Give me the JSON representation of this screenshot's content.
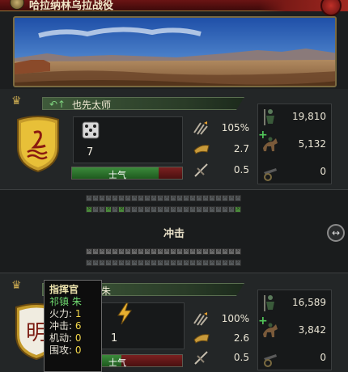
{
  "window": {
    "title": "哈拉纳林乌拉战役"
  },
  "phase": {
    "label": "冲击"
  },
  "attacker": {
    "leader": "也先太师",
    "dice": "7",
    "morale_label": "士气",
    "morale": 0.79,
    "stats": [
      {
        "icon": "fire-icon",
        "value": "105%"
      },
      {
        "icon": "shock-icon",
        "value": "2.7"
      },
      {
        "icon": "siege-icon",
        "value": "0.5"
      }
    ],
    "forces": [
      {
        "icon": "infantry-icon",
        "value": "19,810"
      },
      {
        "icon": "cavalry-icon",
        "value": "5,132"
      },
      {
        "icon": "artillery-icon",
        "value": "0"
      }
    ]
  },
  "defender": {
    "leader": "朱",
    "dice": "1",
    "morale_label": "士气",
    "morale": 0.45,
    "stats": [
      {
        "icon": "fire-icon",
        "value": "100%"
      },
      {
        "icon": "shock-icon",
        "value": "2.6"
      },
      {
        "icon": "siege-icon",
        "value": "0.5"
      }
    ],
    "forces": [
      {
        "icon": "infantry-icon",
        "value": "16,589"
      },
      {
        "icon": "cavalry-icon",
        "value": "3,842"
      },
      {
        "icon": "artillery-icon",
        "value": "0"
      }
    ]
  },
  "tooltip": {
    "title": "指挥官",
    "name": "祁镇 朱",
    "rows": [
      {
        "label": "火力: ",
        "value": "1"
      },
      {
        "label": "冲击: ",
        "value": "6"
      },
      {
        "label": "机动: ",
        "value": "0"
      },
      {
        "label": "围攻: ",
        "value": "0"
      }
    ]
  },
  "colors": {
    "morale_green": "#3c8a3c",
    "morale_red": "#7a2020",
    "leader_bar": "#3f5a3a",
    "title_bar": "#6a1414"
  }
}
